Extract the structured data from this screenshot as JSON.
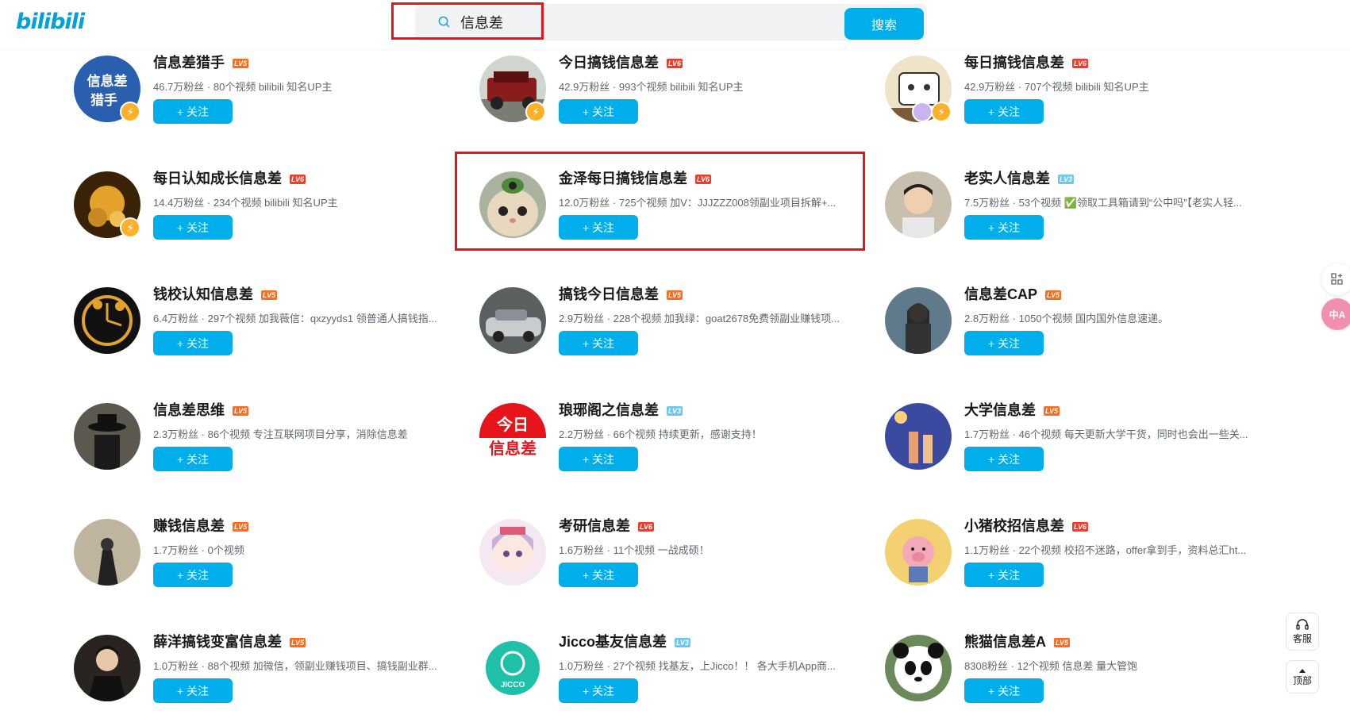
{
  "header": {
    "logo": "bilibili",
    "search_value": "信息差",
    "search_button": "搜索"
  },
  "follow_label": "+ 关注",
  "cards": [
    {
      "name": "信息差猎手",
      "level": "LV5",
      "meta": "46.7万粉丝 · 80个视频  bilibili 知名UP主"
    },
    {
      "name": "今日搞钱信息差",
      "level": "LV6",
      "meta": "42.9万粉丝 · 993个视频  bilibili 知名UP主"
    },
    {
      "name": "每日搞钱信息差",
      "level": "LV6",
      "meta": "42.9万粉丝 · 707个视频  bilibili 知名UP主"
    },
    {
      "name": "每日认知成长信息差",
      "level": "LV6",
      "meta": "14.4万粉丝 · 234个视频  bilibili 知名UP主"
    },
    {
      "name": "金泽每日搞钱信息差",
      "level": "LV6",
      "meta": "12.0万粉丝 · 725个视频  加V：JJJZZZ008领副业项目拆解+..."
    },
    {
      "name": "老实人信息差",
      "level": "LV3",
      "meta": "7.5万粉丝 · 53个视频  ✅领取工具箱请到“公中吗”【老实人轻..."
    },
    {
      "name": "钱校认知信息差",
      "level": "LV5",
      "meta": "6.4万粉丝 · 297个视频  加我薇信：qxzyyds1 领普通人搞钱指..."
    },
    {
      "name": "搞钱今日信息差",
      "level": "LV5",
      "meta": "2.9万粉丝 · 228个视频  加我绿：goat2678免费领副业赚钱项..."
    },
    {
      "name": "信息差CAP",
      "level": "LV5",
      "meta": "2.8万粉丝 · 1050个视频  国内国外信息速递。"
    },
    {
      "name": "信息差思维",
      "level": "LV5",
      "meta": "2.3万粉丝 · 86个视频  专注互联网项目分享，消除信息差"
    },
    {
      "name": "琅琊阁之信息差",
      "level": "LV3",
      "meta": "2.2万粉丝 · 66个视频  持续更新，感谢支持！"
    },
    {
      "name": "大学信息差",
      "level": "LV5",
      "meta": "1.7万粉丝 · 46个视频  每天更新大学干货，同时也会出一些关..."
    },
    {
      "name": "赚钱信息差",
      "level": "LV5",
      "meta": "1.7万粉丝 · 0个视频"
    },
    {
      "name": "考研信息差",
      "level": "LV6",
      "meta": "1.6万粉丝 · 11个视频  一战成硕！"
    },
    {
      "name": "小猪校招信息差",
      "level": "LV6",
      "meta": "1.1万粉丝 · 22个视频  校招不迷路，offer拿到手，资料总汇ht..."
    },
    {
      "name": "薛洋搞钱变富信息差",
      "level": "LV5",
      "meta": "1.0万粉丝 · 88个视频  加微信，领副业赚钱项目、搞钱副业群..."
    },
    {
      "name": "Jicco基友信息差",
      "level": "LV3",
      "meta": "1.0万粉丝 · 27个视频  找基友，上Jicco！！ 各大手机App商..."
    },
    {
      "name": "熊猫信息差A",
      "level": "LV5",
      "meta": "8308粉丝 · 12个视频  信息差 量大管饱"
    }
  ],
  "avatar_text": {
    "a0_line1": "信息差",
    "a0_line2": "猎手",
    "a10_line1": "今日",
    "a10_line2": "信息差",
    "a16": "JICCO"
  },
  "sidebar": {
    "service": "客服",
    "top": "顶部"
  },
  "colors": {
    "accent": "#00aeec",
    "highlight": "#e8141c"
  }
}
